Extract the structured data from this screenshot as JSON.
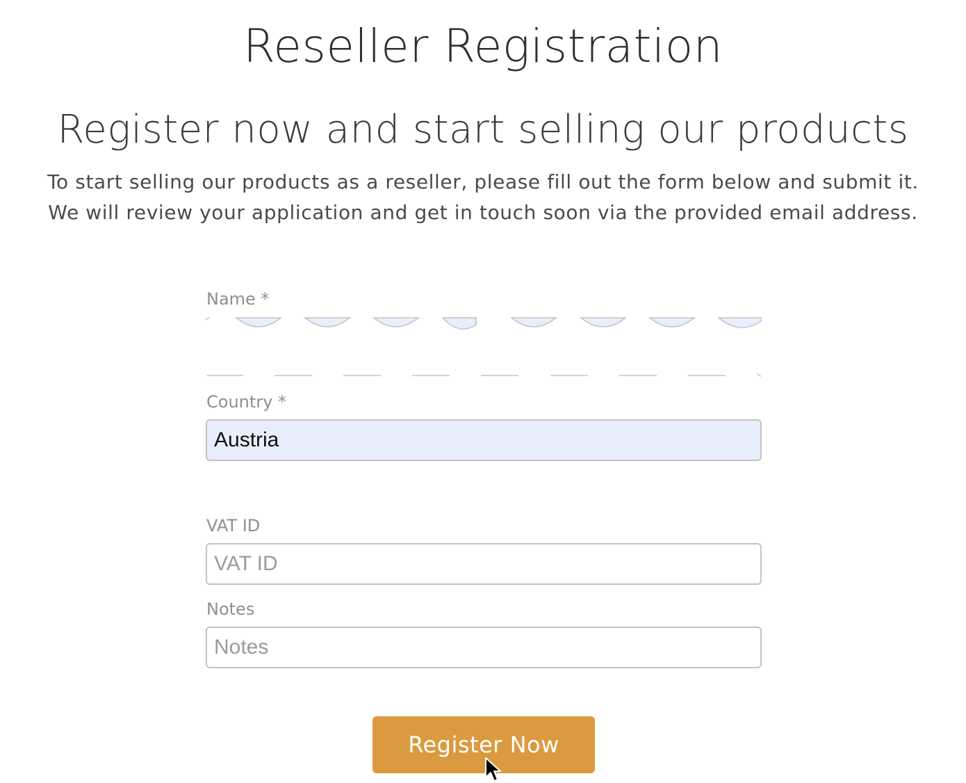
{
  "header": {
    "title": "Reseller Registration",
    "subtitle": "Register now and start selling our products",
    "intro_line_1": "To start selling our products as a reseller, please fill out the form below and submit it.",
    "intro_line_2": "We will review your application and get in touch soon via the provided email address."
  },
  "form": {
    "name": {
      "label": "Name *",
      "value": ""
    },
    "country": {
      "label": "Country *",
      "value": "Austria"
    },
    "vat_id": {
      "label": "VAT ID",
      "placeholder": "VAT ID",
      "value": ""
    },
    "notes": {
      "label": "Notes",
      "placeholder": "Notes",
      "value": ""
    },
    "submit_label": "Register Now"
  },
  "colors": {
    "accent": "#db9a3f",
    "autofill_bg": "#e8eefc",
    "label": "#8f8f8f"
  },
  "icons": {
    "cursor": "mouse-pointer-icon"
  }
}
